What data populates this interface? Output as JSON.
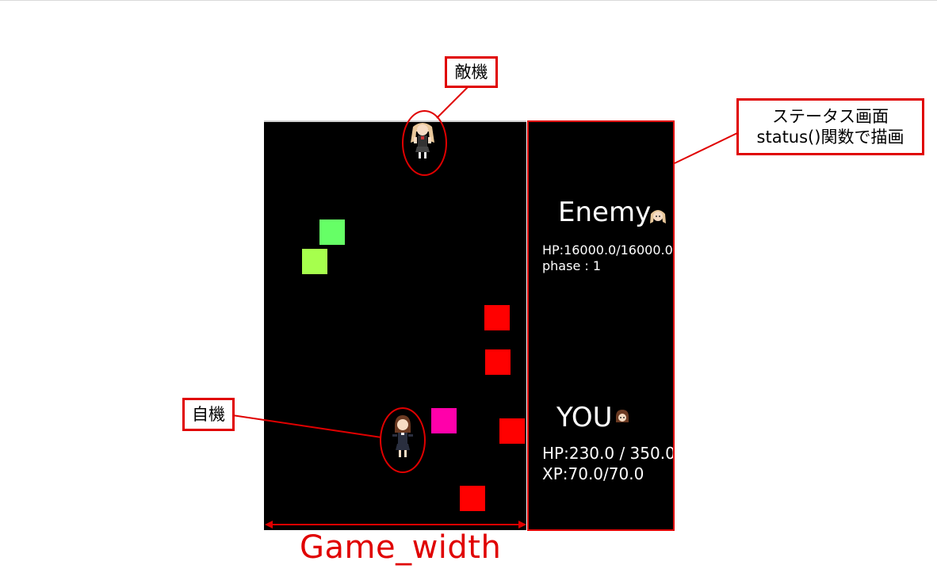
{
  "callouts": {
    "enemy": "敵機",
    "player": "自機",
    "status_line1": "ステータス画面",
    "status_line2": "status()関数で描画"
  },
  "status": {
    "enemy_title": "Enemy",
    "enemy_hp": "HP:16000.0/16000.0",
    "enemy_phase": "phase : 1",
    "player_title": "YOU",
    "player_hp": "HP:230.0 / 350.0",
    "player_xp": "XP:70.0/70.0"
  },
  "dimension_label": "Game_width",
  "colors": {
    "annotation": "#e00000",
    "game_bg": "#000000",
    "bullet_green_1": "#66ff66",
    "bullet_green_2": "#a6ff4d",
    "bullet_red": "#ff0000",
    "bullet_magenta": "#ff00aa"
  }
}
